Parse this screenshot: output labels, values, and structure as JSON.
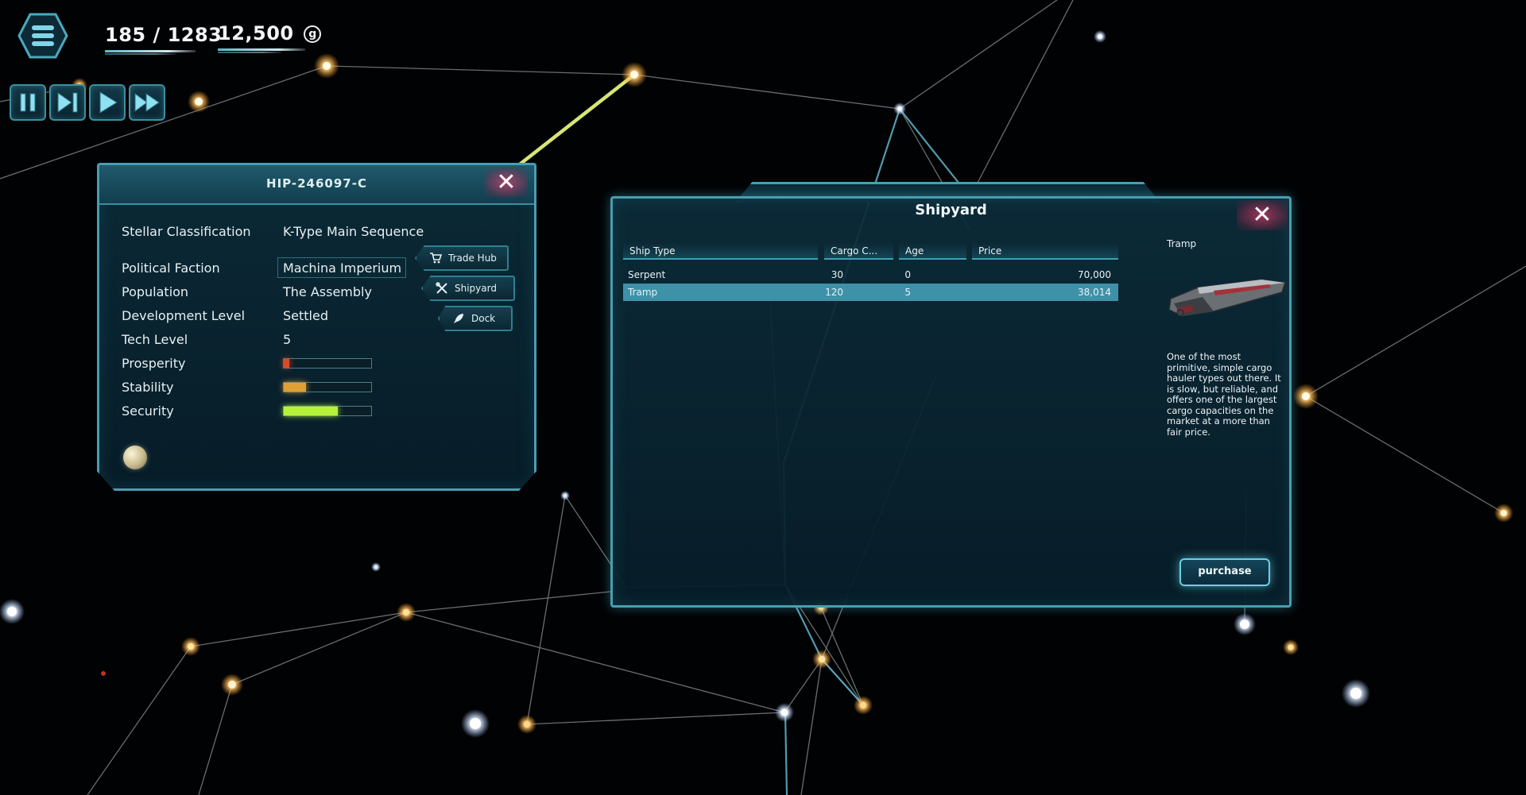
{
  "hud": {
    "population": "185 / 1283",
    "credits": "12,500",
    "credit_symbol": "g",
    "speed_controls": [
      "pause-icon",
      "step-forward-icon",
      "play-icon",
      "fast-forward-icon"
    ]
  },
  "system_panel": {
    "title": "HIP-246097-C",
    "rows": [
      {
        "label": "Stellar Classification",
        "value": "K-Type Main Sequence"
      },
      {
        "label": "Political Faction",
        "value": "Machina Imperium"
      },
      {
        "label": "Population",
        "value": "The Assembly"
      },
      {
        "label": "Development Level",
        "value": "Settled"
      },
      {
        "label": "Tech Level",
        "value": "5"
      }
    ],
    "meters": [
      {
        "label": "Prosperity",
        "level": 0.06,
        "color": "#d84b2a"
      },
      {
        "label": "Stability",
        "level": 0.25,
        "color": "#e0a033"
      },
      {
        "label": "Security",
        "level": 0.62,
        "color": "#b7f23a"
      }
    ],
    "actions": [
      {
        "label": "Trade Hub",
        "icon": "cart-icon"
      },
      {
        "label": "Shipyard",
        "icon": "tools-icon"
      },
      {
        "label": "Dock",
        "icon": "rocket-icon"
      }
    ]
  },
  "shipyard": {
    "title": "Shipyard",
    "columns": [
      "Ship Type",
      "Cargo C...",
      "Age",
      "Price"
    ],
    "rows": [
      {
        "type": "Serpent",
        "cargo": "30",
        "age": "0",
        "price": "70,000",
        "selected": false
      },
      {
        "type": "Tramp",
        "cargo": "120",
        "age": "5",
        "price": "38,014",
        "selected": true
      }
    ],
    "detail": {
      "name": "Tramp",
      "description": "One of the most primitive, simple cargo hauler types out there. It is slow, but reliable, and offers one of the largest cargo capacities on the market at a more than fair price."
    },
    "purchase_label": "purchase"
  },
  "colors": {
    "panel_border": "#4a9db0",
    "accent_cyan": "#6ad0e6",
    "close_red": "#e8406e",
    "route_highlight": "#e4f27a"
  }
}
